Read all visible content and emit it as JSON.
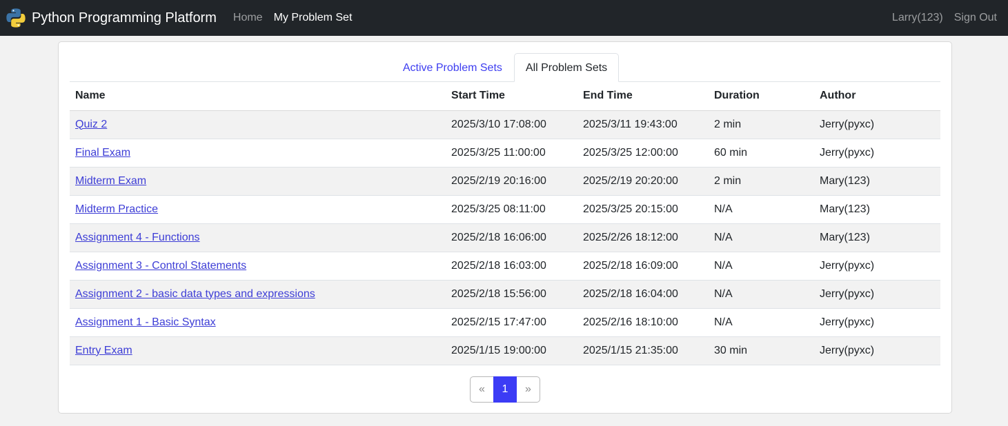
{
  "navbar": {
    "brand": "Python Programming Platform",
    "links": [
      {
        "label": "Home"
      },
      {
        "label": "My Problem Set"
      }
    ],
    "user": "Larry(123)",
    "signout": "Sign Out"
  },
  "tabs": [
    {
      "label": "Active Problem Sets"
    },
    {
      "label": "All Problem Sets"
    }
  ],
  "table": {
    "headers": [
      "Name",
      "Start Time",
      "End Time",
      "Duration",
      "Author"
    ],
    "rows": [
      {
        "name": "Quiz 2",
        "start": "2025/3/10 17:08:00",
        "end": "2025/3/11 19:43:00",
        "duration": "2 min",
        "author": "Jerry(pyxc)"
      },
      {
        "name": "Final Exam",
        "start": "2025/3/25 11:00:00",
        "end": "2025/3/25 12:00:00",
        "duration": "60 min",
        "author": "Jerry(pyxc)"
      },
      {
        "name": "Midterm Exam",
        "start": "2025/2/19 20:16:00",
        "end": "2025/2/19 20:20:00",
        "duration": "2 min",
        "author": "Mary(123)"
      },
      {
        "name": "Midterm Practice",
        "start": "2025/3/25 08:11:00",
        "end": "2025/3/25 20:15:00",
        "duration": "N/A",
        "author": "Mary(123)"
      },
      {
        "name": "Assignment 4 - Functions",
        "start": "2025/2/18 16:06:00",
        "end": "2025/2/26 18:12:00",
        "duration": "N/A",
        "author": "Mary(123)"
      },
      {
        "name": "Assignment 3 - Control Statements",
        "start": "2025/2/18 16:03:00",
        "end": "2025/2/18 16:09:00",
        "duration": "N/A",
        "author": "Jerry(pyxc)"
      },
      {
        "name": "Assignment 2 - basic data types and expressions",
        "start": "2025/2/18 15:56:00",
        "end": "2025/2/18 16:04:00",
        "duration": "N/A",
        "author": "Jerry(pyxc)"
      },
      {
        "name": "Assignment 1 - Basic Syntax",
        "start": "2025/2/15 17:47:00",
        "end": "2025/2/16 18:10:00",
        "duration": "N/A",
        "author": "Jerry(pyxc)"
      },
      {
        "name": "Entry Exam",
        "start": "2025/1/15 19:00:00",
        "end": "2025/1/15 21:35:00",
        "duration": "30 min",
        "author": "Jerry(pyxc)"
      }
    ]
  },
  "pagination": {
    "prev": "«",
    "current": "1",
    "next": "»"
  },
  "icons": {
    "brand": "python-logo-icon"
  },
  "colors": {
    "navbar_bg": "#212529",
    "link": "#3d3dd6",
    "tab_link": "#3d3df0",
    "page_active": "#3c3cf5",
    "python_blue": "#3b73a6",
    "python_yellow": "#f2cd3c"
  }
}
